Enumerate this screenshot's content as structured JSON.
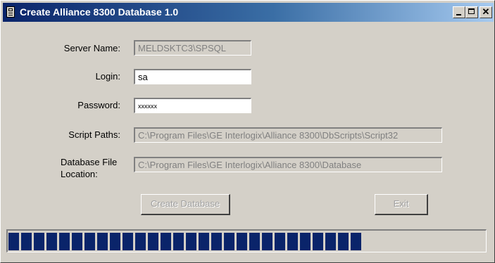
{
  "window": {
    "title": "Create Alliance 8300 Database 1.0"
  },
  "form": {
    "server_name": {
      "label": "Server Name:",
      "value": "MELDSKTC3\\SPSQL"
    },
    "login": {
      "label": "Login:",
      "value": "sa"
    },
    "password": {
      "label": "Password:",
      "value": "xxxxxx"
    },
    "script_paths": {
      "label": "Script Paths:",
      "value": "C:\\Program Files\\GE Interlogix\\Alliance 8300\\DbScripts\\Script32"
    },
    "db_location": {
      "label_line1": "Database File",
      "label_line2": "Location:",
      "value": "C:\\Program Files\\GE Interlogix\\Alliance 8300\\Database"
    }
  },
  "buttons": {
    "create_database": "Create Database",
    "exit": "Exit"
  },
  "progress": {
    "percent": 77,
    "color": "#0a246a"
  }
}
